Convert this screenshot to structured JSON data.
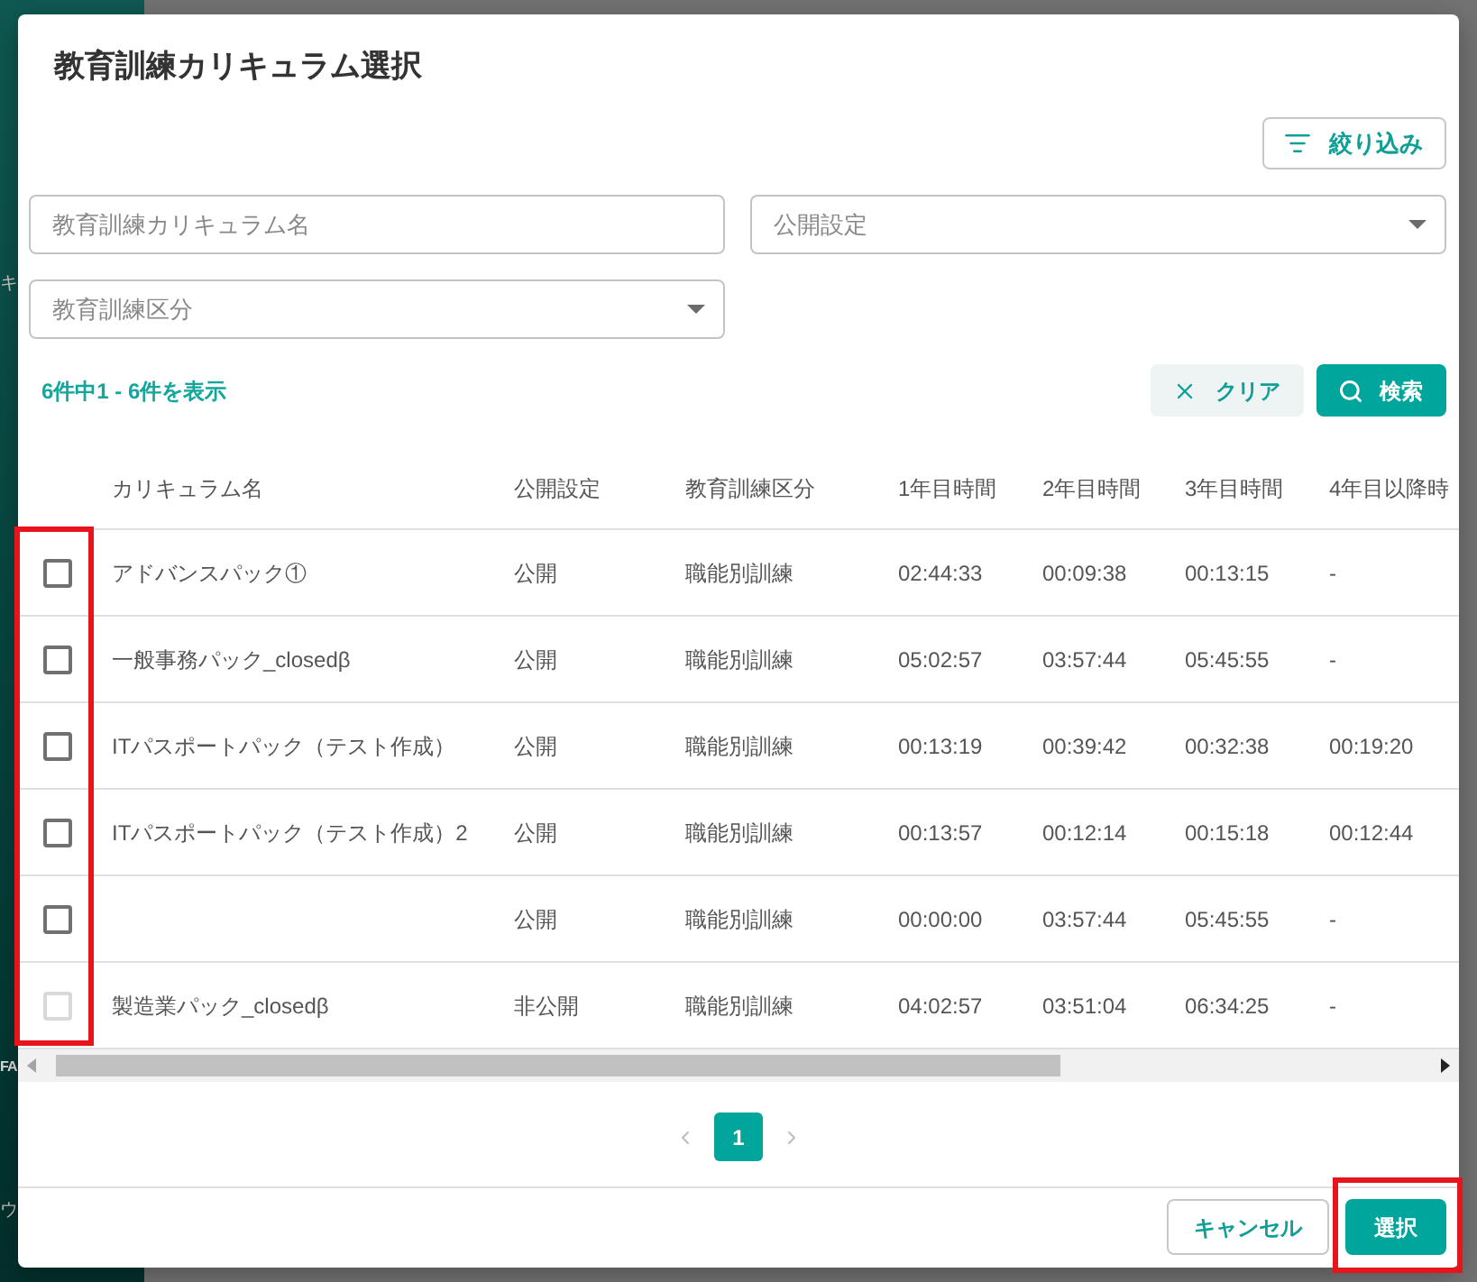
{
  "background": {
    "sidebar_fragments": [
      "キ",
      "FA",
      "ウ"
    ]
  },
  "dialog": {
    "title": "教育訓練カリキュラム選択",
    "filter_button": {
      "label": "絞り込み"
    },
    "fields": [
      {
        "kind": "text",
        "placeholder": "教育訓練カリキュラム名"
      },
      {
        "kind": "select",
        "placeholder": "公開設定"
      },
      {
        "kind": "select",
        "placeholder": "教育訓練区分"
      }
    ],
    "result_count": "6件中1 - 6件を表示",
    "clear_button": {
      "label": "クリア"
    },
    "search_button": {
      "label": "検索"
    },
    "table": {
      "checkbox_column_highlighted": true,
      "columns": [
        "カリキュラム名",
        "公開設定",
        "教育訓練区分",
        "1年目時間",
        "2年目時間",
        "3年目時間",
        "4年目以降時"
      ],
      "rows": [
        {
          "checked": false,
          "disabled": false,
          "name": "アドバンスパック①",
          "visibility": "公開",
          "category": "職能別訓練",
          "year1": "02:44:33",
          "year2": "00:09:38",
          "year3": "00:13:15",
          "year4": "-"
        },
        {
          "checked": false,
          "disabled": false,
          "name": "一般事務パック_closedβ",
          "visibility": "公開",
          "category": "職能別訓練",
          "year1": "05:02:57",
          "year2": "03:57:44",
          "year3": "05:45:55",
          "year4": "-"
        },
        {
          "checked": false,
          "disabled": false,
          "name": "ITパスポートパック（テスト作成）",
          "visibility": "公開",
          "category": "職能別訓練",
          "year1": "00:13:19",
          "year2": "00:39:42",
          "year3": "00:32:38",
          "year4": "00:19:20"
        },
        {
          "checked": false,
          "disabled": false,
          "name": "ITパスポートパック（テスト作成）2",
          "visibility": "公開",
          "category": "職能別訓練",
          "year1": "00:13:57",
          "year2": "00:12:14",
          "year3": "00:15:18",
          "year4": "00:12:44"
        },
        {
          "checked": false,
          "disabled": false,
          "visibility": "公開",
          "category": "職能別訓練",
          "year1": "00:00:00",
          "year2": "03:57:44",
          "year3": "05:45:55",
          "year4": "-"
        },
        {
          "checked": false,
          "disabled": true,
          "name": "製造業パック_closedβ",
          "visibility": "非公開",
          "category": "職能別訓練",
          "year1": "04:02:57",
          "year2": "03:51:04",
          "year3": "06:34:25",
          "year4": "-"
        }
      ]
    },
    "pagination": {
      "prev_disabled": true,
      "next_disabled": true,
      "pages": [
        {
          "label": "1",
          "selected": true
        }
      ]
    },
    "footer_buttons": [
      {
        "kind": "secondary",
        "label": "キャンセル",
        "highlighted": false
      },
      {
        "kind": "primary",
        "label": "選択",
        "highlighted": true
      }
    ]
  }
}
